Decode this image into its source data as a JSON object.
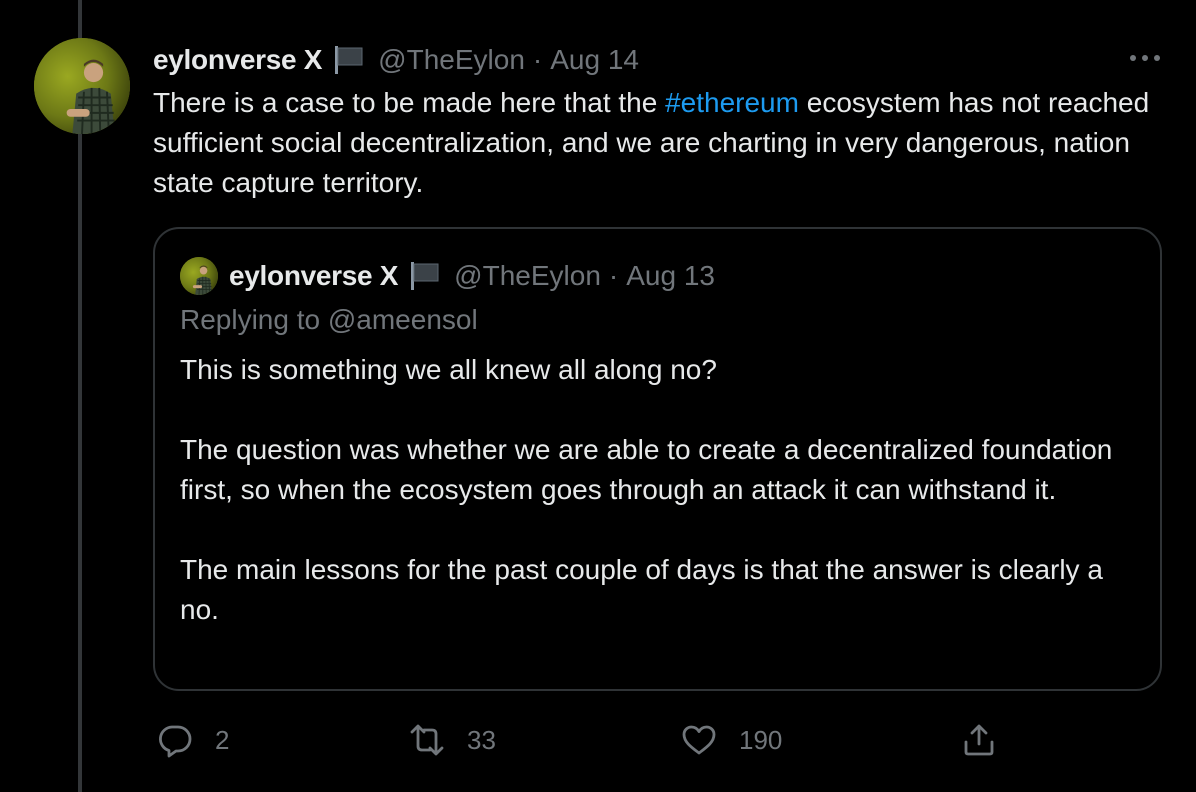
{
  "tweet": {
    "author_name": "eylonverse X",
    "handle": "@TheEylon",
    "separator": "·",
    "date": "Aug 14",
    "text_before": "There is a case to be made here that the ",
    "hashtag": "#ethereum",
    "text_after": " ecosystem has not reached sufficient social decentralization, and we are charting in very dangerous, nation state capture territory."
  },
  "quoted_tweet": {
    "author_name": "eylonverse X",
    "handle": "@TheEylon",
    "separator": "·",
    "date": "Aug 13",
    "replying_to": "Replying to @ameensol",
    "paragraphs": [
      "This is something we all knew all along no?",
      "The question was whether we are able to create a decentralized foundation first, so when the ecosystem goes through an attack it can withstand it.",
      "The main lessons for the past couple of days is that the answer is clearly a no."
    ]
  },
  "actions": {
    "replies": "2",
    "retweets": "33",
    "likes": "190"
  },
  "colors": {
    "background": "#000000",
    "text": "#e7e9ea",
    "muted": "#71767b",
    "accent": "#1d9bf0",
    "border": "#2f3336"
  },
  "icons": [
    "flag-icon",
    "more-icon",
    "reply-icon",
    "retweet-icon",
    "like-icon",
    "share-icon"
  ]
}
